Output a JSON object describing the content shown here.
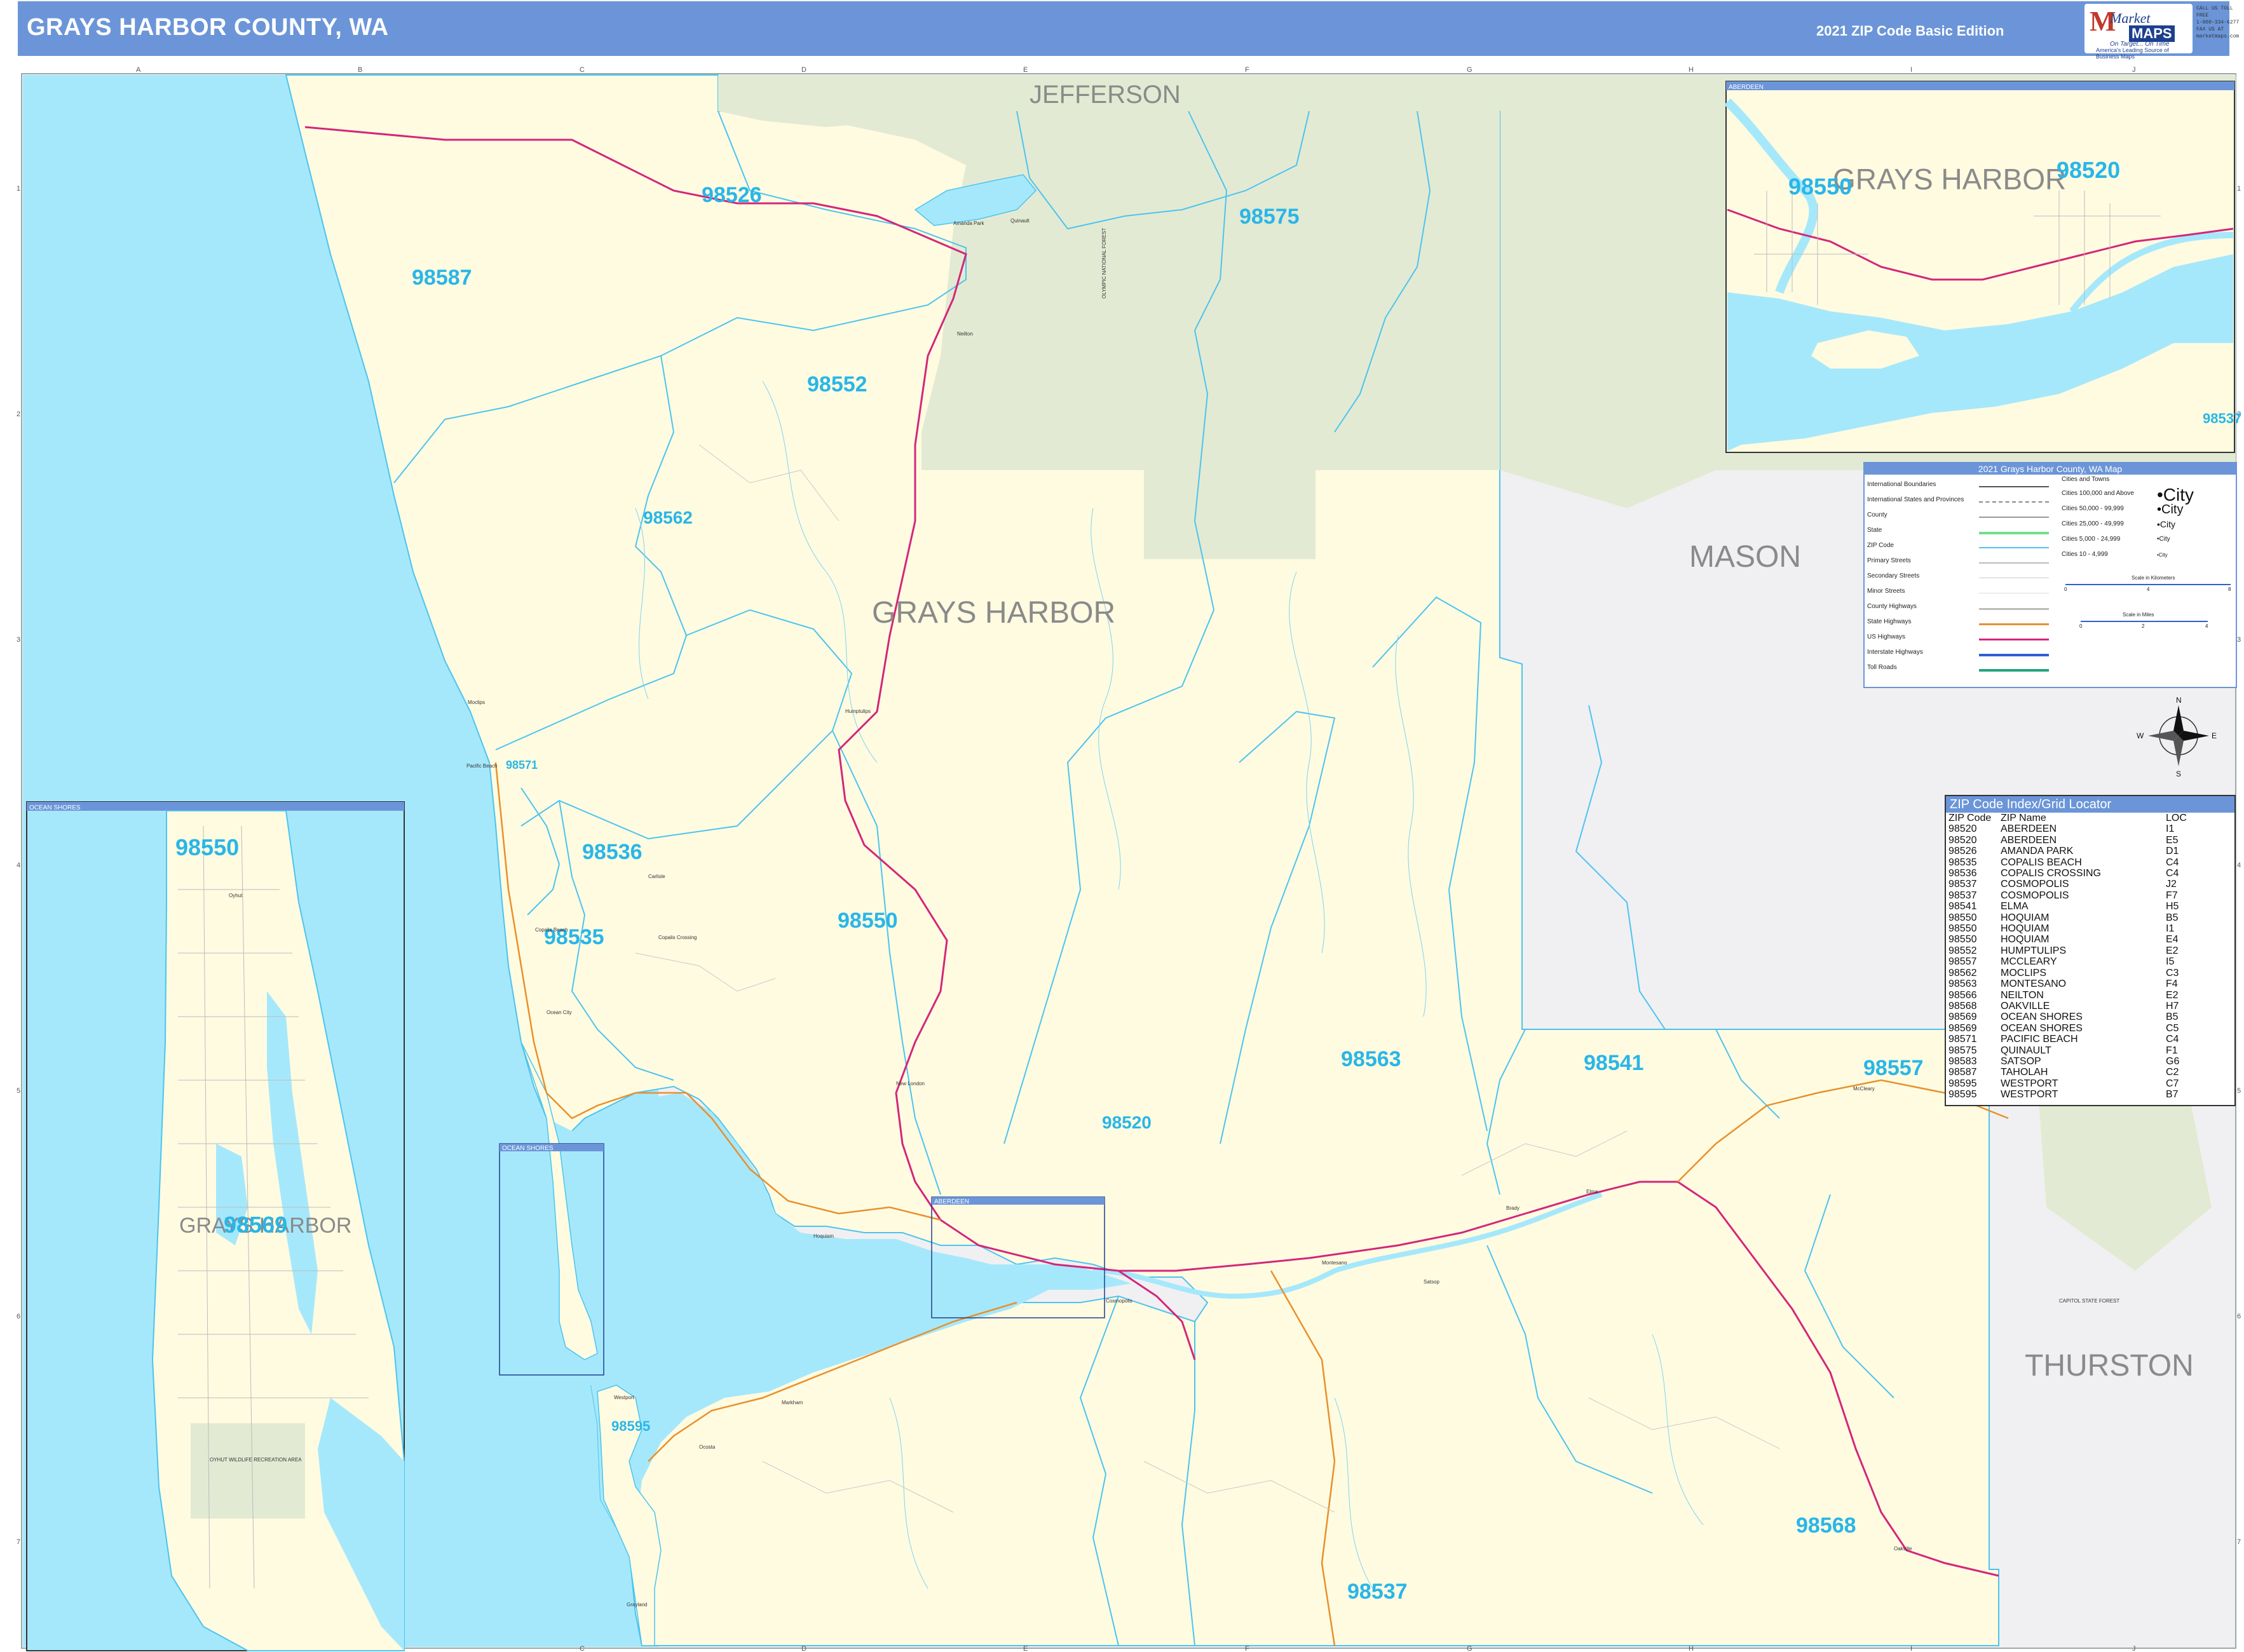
{
  "header": {
    "title": "GRAYS HARBOR COUNTY, WA",
    "edition": "2021 ZIP Code Basic Edition",
    "logo_market": "Market",
    "logo_maps": "MAPS",
    "logo_tagline": "On Target... On Time",
    "logo_subtag": "America's Leading Source of Business Maps",
    "contact_lines": [
      "CALL US TOLL FREE",
      "1-800-334-6277",
      "FAX US AT",
      "marketmaps.com"
    ]
  },
  "grid": {
    "columns": [
      "A",
      "B",
      "C",
      "D",
      "E",
      "F",
      "G",
      "H",
      "I",
      "J"
    ],
    "rows": [
      "1",
      "2",
      "3",
      "4",
      "5",
      "6",
      "7"
    ]
  },
  "counties": {
    "main": "GRAYS HARBOR",
    "jefferson": "JEFFERSON",
    "mason": "MASON",
    "thurston": "THURSTON"
  },
  "zip_labels": {
    "z98526": "98526",
    "z98575": "98575",
    "z98587": "98587",
    "z98552": "98552",
    "z98562": "98562",
    "z98571": "98571",
    "z98536": "98536",
    "z98535": "98535",
    "z98550": "98550",
    "z98563": "98563",
    "z98541": "98541",
    "z98557": "98557",
    "z98520": "98520",
    "z98595": "98595",
    "z98568": "98568",
    "z98537": "98537"
  },
  "places": {
    "amanda_park": "Amanda Park",
    "quinault": "Quinault",
    "neilton": "Neilton",
    "humptulips": "Humptulips",
    "moclips": "Moclips",
    "pacific_beach": "Pacific Beach",
    "copalis_beach": "Copalis Beach",
    "copalis_crossing": "Copalis Crossing",
    "ocean_city": "Ocean City",
    "carlisle": "Carlisle",
    "new_london": "New London",
    "hoquiam": "Hoquiam",
    "aberdeen": "Aberdeen",
    "cosmopolis": "Cosmopolis",
    "montesano": "Montesano",
    "satsop": "Satsop",
    "brady": "Brady",
    "elma": "Elma",
    "mccleary": "McCleary",
    "oakville": "Oakville",
    "westport": "Westport",
    "grayland": "Grayland",
    "ocosta": "Ocosta",
    "markham": "Markham",
    "olympic_forest": "OLYMPIC NATIONAL FOREST",
    "capitol_forest": "CAPITOL STATE FOREST",
    "oyhut": "OYHUT WILDLIFE RECREATION AREA"
  },
  "inset_ocean_shores": {
    "header": "OCEAN SHORES",
    "county": "GRAYS HARBOR",
    "zip_top": "98550",
    "zip_mid": "98569",
    "town": "Oyhut"
  },
  "inset_aberdeen": {
    "header": "ABERDEEN",
    "county": "GRAYS HARBOR",
    "zip_left": "98550",
    "zip_right": "98520",
    "zip_corner": "98537"
  },
  "locator_labels": {
    "ocean_shores": "OCEAN SHORES",
    "aberdeen": "ABERDEEN"
  },
  "legend": {
    "title": "2021 Grays Harbor County, WA Map",
    "items": [
      "International Boundaries",
      "International States and Provinces",
      "County",
      "State",
      "ZIP Code",
      "Primary Streets",
      "Secondary Streets",
      "Minor Streets",
      "County Highways",
      "State Highways",
      "US Highways",
      "Interstate Highways",
      "Toll Roads"
    ],
    "cities_heading": "Cities and Towns",
    "city_classes": [
      {
        "range": "Cities 100,000 and Above",
        "sample": "•City"
      },
      {
        "range": "Cities 50,000 - 99,999",
        "sample": "•City"
      },
      {
        "range": "Cities 25,000 - 49,999",
        "sample": "•City"
      },
      {
        "range": "Cities 5,000 - 24,999",
        "sample": "•City"
      },
      {
        "range": "Cities 10 - 4,999",
        "sample": "•City"
      }
    ],
    "scale_km": "Scale in Kilometers",
    "scale_mi": "Scale in Miles",
    "scale_km_ticks": [
      "0",
      "4",
      "8"
    ],
    "scale_mi_ticks": [
      "0",
      "2",
      "4"
    ]
  },
  "compass": {
    "n": "N",
    "s": "S",
    "e": "E",
    "w": "W"
  },
  "zip_index": {
    "title": "ZIP Code Index/Grid Locator",
    "headers": [
      "ZIP Code",
      "ZIP Name",
      "LOC"
    ],
    "rows": [
      [
        "98520",
        "ABERDEEN",
        "I1"
      ],
      [
        "98520",
        "ABERDEEN",
        "E5"
      ],
      [
        "98526",
        "AMANDA PARK",
        "D1"
      ],
      [
        "98535",
        "COPALIS BEACH",
        "C4"
      ],
      [
        "98536",
        "COPALIS CROSSING",
        "C4"
      ],
      [
        "98537",
        "COSMOPOLIS",
        "J2"
      ],
      [
        "98537",
        "COSMOPOLIS",
        "F7"
      ],
      [
        "98541",
        "ELMA",
        "H5"
      ],
      [
        "98550",
        "HOQUIAM",
        "B5"
      ],
      [
        "98550",
        "HOQUIAM",
        "I1"
      ],
      [
        "98550",
        "HOQUIAM",
        "E4"
      ],
      [
        "98552",
        "HUMPTULIPS",
        "E2"
      ],
      [
        "98557",
        "MCCLEARY",
        "I5"
      ],
      [
        "98562",
        "MOCLIPS",
        "C3"
      ],
      [
        "98563",
        "MONTESANO",
        "F4"
      ],
      [
        "98566",
        "NEILTON",
        "E2"
      ],
      [
        "98568",
        "OAKVILLE",
        "H7"
      ],
      [
        "98569",
        "OCEAN SHORES",
        "B5"
      ],
      [
        "98569",
        "OCEAN SHORES",
        "C5"
      ],
      [
        "98571",
        "PACIFIC BEACH",
        "C4"
      ],
      [
        "98575",
        "QUINAULT",
        "F1"
      ],
      [
        "98583",
        "SATSOP",
        "G6"
      ],
      [
        "98587",
        "TAHOLAH",
        "C2"
      ],
      [
        "98595",
        "WESTPORT",
        "C7"
      ],
      [
        "98595",
        "WESTPORT",
        "B7"
      ]
    ]
  },
  "colors": {
    "header_blue": "#6b95d8",
    "water": "#a6e8fb",
    "county_land": "#fffbe1",
    "forest": "#e3ead3",
    "adjacent": "#f0f0f2",
    "zip_line": "#4cc4ef",
    "us_hwy": "#d4267a",
    "state_hwy": "#e8902c",
    "zip_label": "#29b6e8"
  }
}
